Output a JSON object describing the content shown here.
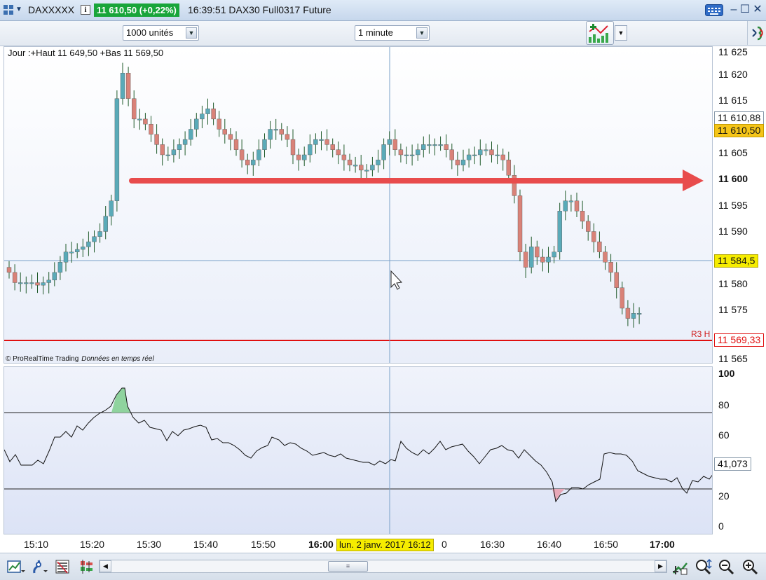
{
  "window": {
    "instrument": "DAXXXXX",
    "price_badge": "11 610,50 (+0,22%)",
    "title": "16:39:51 DAX30 Full0317 Future"
  },
  "toolbar": {
    "units_select": "1000 unités",
    "interval_select": "1 minute"
  },
  "price_chart": {
    "info": "Jour :+Haut 11 649,50 +Bas 11 569,50",
    "credit": "© ProRealTime Trading",
    "credit_sub": "Données en temps réel",
    "r3_label": "R3 H",
    "axis_labels": [
      "11 625",
      "11 620",
      "11 615",
      "11 610",
      "11 605",
      "11 600",
      "11 595",
      "11 590",
      "11 580",
      "11 575",
      "11 570",
      "11 565"
    ],
    "tags": {
      "high_tag": "11 610,88",
      "last_price_tag": "11 610,50",
      "cursor_price_tag": "11 584,5",
      "r3_tag": "11 569,33"
    },
    "colors": {
      "up": "#5aaab8",
      "down": "#d98278",
      "arrow": "#e84c4c",
      "r3_line": "#e01010"
    }
  },
  "rsi_chart": {
    "axis_labels": [
      "100",
      "80",
      "60",
      "20",
      "0"
    ],
    "current_tag": "41,073"
  },
  "time_axis": {
    "labels": [
      "15:10",
      "15:20",
      "15:30",
      "15:40",
      "15:50",
      "16:00",
      "16:30",
      "16:40",
      "16:50",
      "17:00"
    ],
    "partial_label": "0",
    "cursor_date": "lun. 2 janv. 2017 16:12"
  },
  "bottombar": {
    "icons": [
      "chart-settings-icon",
      "drawing-tools-icon",
      "order-book-icon",
      "indicators-icon",
      "auto-scale-icon",
      "zoom-fit-icon",
      "zoom-out-icon",
      "zoom-in-icon"
    ]
  }
}
